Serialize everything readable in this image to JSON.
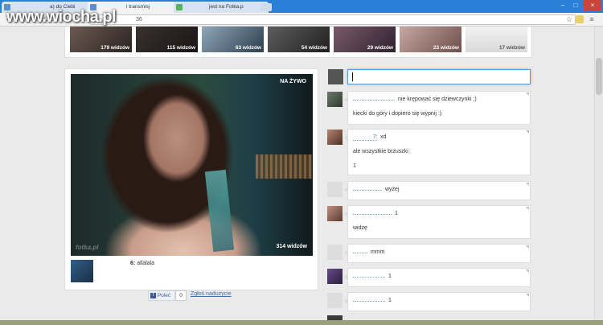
{
  "browser": {
    "tabs": [
      {
        "label": "a) do Ciebi",
        "close": "×"
      },
      {
        "label": "i transmisj",
        "close": "×"
      },
      {
        "label": "jest na Fotka.p",
        "close": "×"
      }
    ],
    "controls": [
      "–",
      "□"
    ],
    "close": "×",
    "url": "36",
    "back": "←",
    "forward": "→",
    "reload": "C",
    "home": "⌂",
    "star": "☆",
    "menu": "≡"
  },
  "watermark_logo": "www.wiocha.pl",
  "thumbnails": [
    {
      "viewers": "179 widzów"
    },
    {
      "viewers": "115 widzów"
    },
    {
      "viewers": "63 widzów"
    },
    {
      "viewers": "54 widzów"
    },
    {
      "viewers": "29 widzów"
    },
    {
      "viewers": "23 widzów"
    },
    {
      "viewers": "17 widzów"
    }
  ],
  "stream": {
    "live_label": "NA ŻYWO",
    "viewers": "314 widzów",
    "watermark": "fotka.pl",
    "caption_user": "6:",
    "caption_text": "allalala"
  },
  "share": {
    "fb_label": "Poleć",
    "fb_count": "0",
    "report_label": "Zgłoś nadużycie"
  },
  "comments": [
    {
      "user": "",
      "lines": [
        "nie krępować się dziewczynki :)",
        "kiecki do góry i dopiero się wypnij :)"
      ]
    },
    {
      "user": "7:",
      "lines": [
        "xd",
        "ale wszystkie brzuszki",
        "1"
      ]
    },
    {
      "user": "",
      "lines": [
        "wyżej"
      ]
    },
    {
      "user": "",
      "lines": [
        "1",
        "widzę"
      ]
    },
    {
      "user": "",
      "lines": [
        "mmm"
      ]
    },
    {
      "user": "",
      "lines": [
        "1"
      ]
    },
    {
      "user": "",
      "lines": [
        "1"
      ]
    }
  ],
  "colors": {
    "chrome_blue": "#2a7fd6",
    "link": "#3b6db5",
    "input_focus": "#5b9bd5"
  }
}
